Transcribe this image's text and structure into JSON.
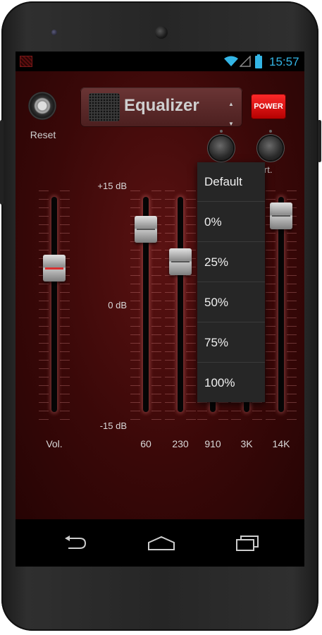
{
  "status_bar": {
    "time": "15:57",
    "icons": [
      "app-icon",
      "wifi-icon",
      "signal-icon",
      "battery-icon"
    ]
  },
  "header": {
    "reset_label": "Reset",
    "title": "Equalizer",
    "power_label": "POWER",
    "virt_label": "irt."
  },
  "scale": {
    "top": "+15 dB",
    "mid": "0 dB",
    "bottom": "-15 dB"
  },
  "sliders": [
    {
      "label": "Vol.",
      "level": 0.67
    },
    {
      "label": "60",
      "level": 0.85
    },
    {
      "label": "230",
      "level": 0.7
    },
    {
      "label": "910",
      "level": null
    },
    {
      "label": "3K",
      "level": null
    },
    {
      "label": "14K",
      "level": 0.91
    }
  ],
  "dropdown": {
    "options": [
      "Default",
      "0%",
      "25%",
      "50%",
      "75%",
      "100%"
    ]
  },
  "nav": {
    "icons": [
      "back-icon",
      "home-icon",
      "recents-icon"
    ]
  },
  "colors": {
    "accent": "#33b5e5",
    "power": "#e00000",
    "background": "#3a0808"
  }
}
